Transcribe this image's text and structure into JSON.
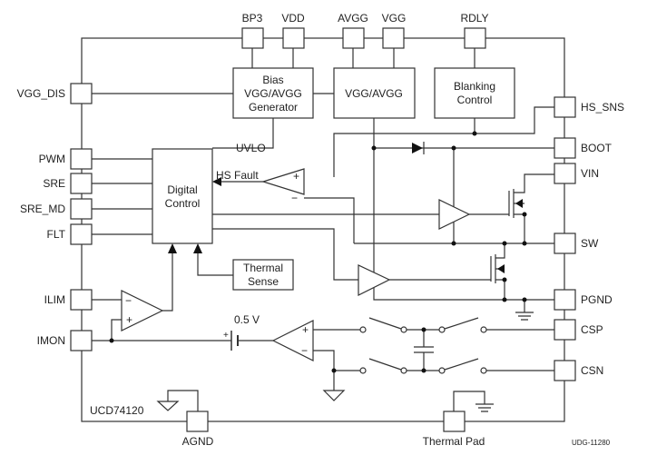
{
  "part_name": "UCD74120",
  "figure_id": "UDG-11280",
  "pins": {
    "top": [
      "BP3",
      "VDD",
      "AVGG",
      "VGG",
      "RDLY"
    ],
    "left": [
      "VGG_DIS",
      "PWM",
      "SRE",
      "SRE_MD",
      "FLT",
      "ILIM",
      "IMON"
    ],
    "right": [
      "HS_SNS",
      "BOOT",
      "VIN",
      "SW",
      "PGND",
      "CSP",
      "CSN"
    ],
    "bottom": [
      "AGND",
      "Thermal Pad"
    ]
  },
  "blocks": {
    "bias": [
      "Bias",
      "VGG/AVGG",
      "Generator"
    ],
    "vgg": "VGG/AVGG",
    "blanking": [
      "Blanking",
      "Control"
    ],
    "digital": [
      "Digital",
      "Control"
    ],
    "thermal": [
      "Thermal",
      "Sense"
    ]
  },
  "labels": {
    "uvlo": "UVLO",
    "hs_fault": "HS Fault",
    "ref_voltage": "0.5 V",
    "plus": "+",
    "minus": "−"
  }
}
